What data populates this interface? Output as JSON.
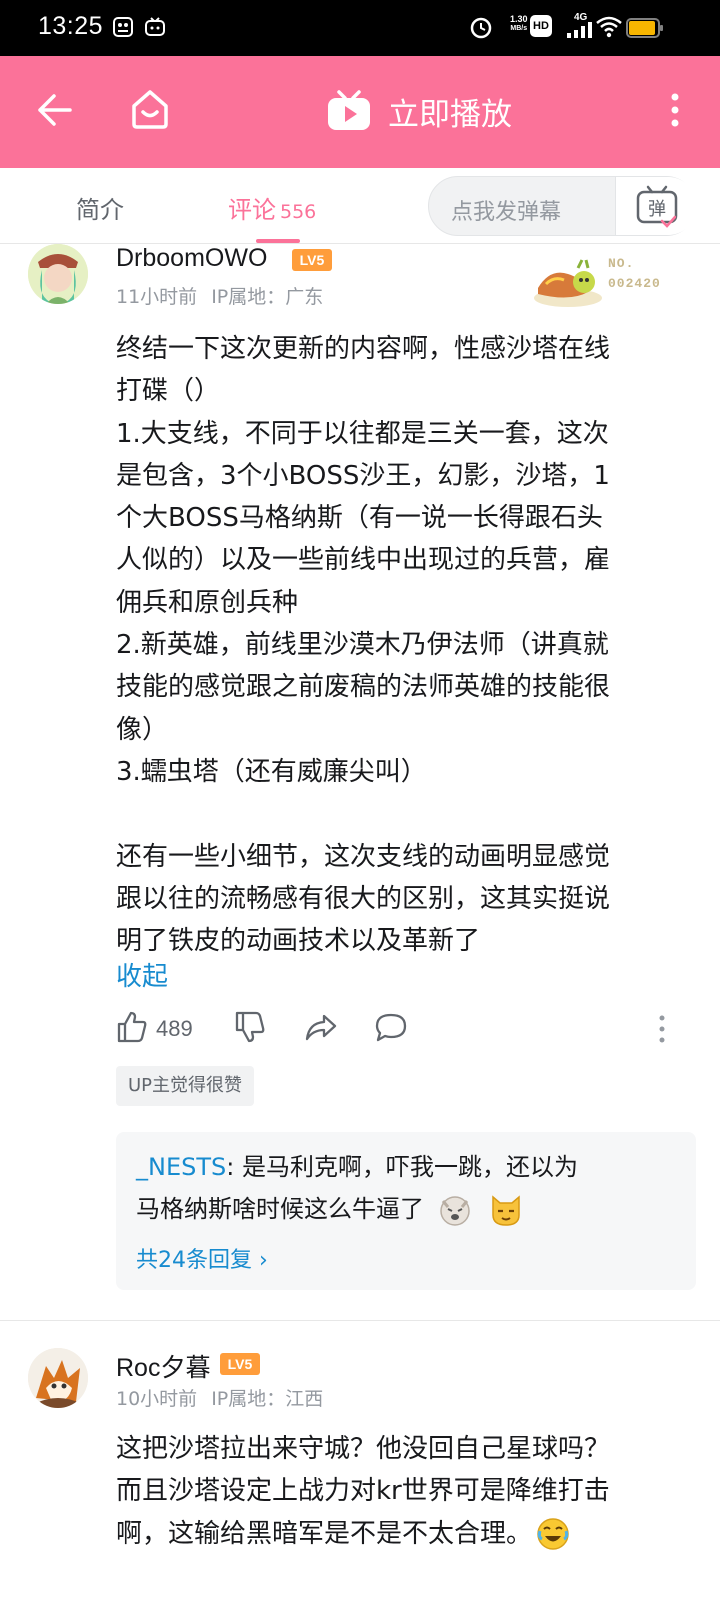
{
  "status_bar": {
    "time": "13:25",
    "net_speed_value": "1.30",
    "net_speed_unit": "MB/s",
    "network": "4G",
    "hd": "HD"
  },
  "header": {
    "play_label": "立即播放"
  },
  "tabs": {
    "intro": "简介",
    "comments": "评论",
    "comment_count": "556"
  },
  "danmaku": {
    "placeholder": "点我发弹幕",
    "button_glyph": "弹"
  },
  "comments": [
    {
      "username": "DrboomOWO",
      "level": "LV5",
      "time": "11小时前",
      "ip": "IP属地：广东",
      "fan_badge_no": "NO.",
      "fan_badge_num": "002420",
      "text": "终结一下这次更新的内容啊，性感沙塔在线\n打碟（）\n1.大支线，不同于以往都是三关一套，这次\n是包含，3个小BOSS沙王，幻影，沙塔，1\n个大BOSS马格纳斯（有一说一长得跟石头\n人似的）以及一些前线中出现过的兵营，雇\n佣兵和原创兵种\n2.新英雄，前线里沙漠木乃伊法师（讲真就\n技能的感觉跟之前废稿的法师英雄的技能很\n像）\n3.蠕虫塔（还有威廉尖叫）\n\n还有一些小细节，这次支线的动画明显感觉\n跟以往的流畅感有很大的区别，这其实挺说\n明了铁皮的动画技术以及革新了",
      "collapse_label": "收起",
      "likes": "489",
      "up_badge": "UP主觉得很赞",
      "reply_user": "_NESTS",
      "reply_text_line1": ": 是马利克啊，吓我一跳，还以为",
      "reply_text_line2": "马格纳斯啥时候这么牛逼了",
      "reply_more": "共24条回复 ›"
    },
    {
      "username": "Roc夕暮",
      "level": "LV5",
      "time": "10小时前",
      "ip": "IP属地：江西",
      "text": "这把沙塔拉出来守城？他没回自己星球吗？\n而且沙塔设定上战力对kr世界可是降维打击\n啊，这输给黑暗军是不是不太合理。"
    }
  ],
  "colors": {
    "brand_pink": "#fb7299",
    "link_blue": "#178bcf",
    "level_orange": "#ff9d3b"
  }
}
